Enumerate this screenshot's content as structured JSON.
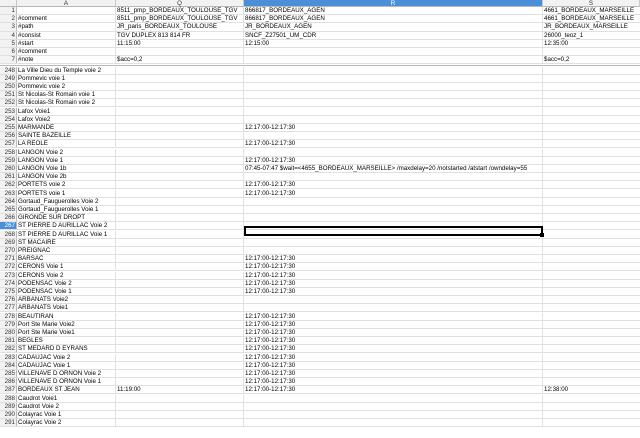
{
  "columns": [
    "A",
    "Q",
    "R",
    "S"
  ],
  "selected_column": "R",
  "selected_row": "267",
  "top_rows": [
    {
      "num": "1",
      "a": "",
      "q": "8511_pmp_BORDEAUX_TOULOUSE_TGV",
      "r": "866817_BORDEAUX_AGEN",
      "s": "4661_BORDEAUX_MARSEILLE"
    },
    {
      "num": "2",
      "a": "#comment",
      "q": "8511_pmp_BORDEAUX_TOULOUSE_TGV",
      "r": "866817_BORDEAUX_AGEN",
      "s": "4661_BORDEAUX_MARSEILLE"
    },
    {
      "num": "3",
      "a": "#path",
      "q": "JR_paris_BORDEAUX_TOULOUSE",
      "r": "JR_BORDEAUX_AGEN",
      "s": "JR_BORDEAUX_MARSEILLE"
    },
    {
      "num": "4",
      "a": "#consist",
      "q": "TGV DUPLEX 813 814 FR",
      "r": "SNCF_Z27501_UM_CDR",
      "s": "26000_teoz_1"
    },
    {
      "num": "5",
      "a": "#start",
      "q": "11:15:00",
      "r": "12:15:00",
      "s": "12:35:00"
    },
    {
      "num": "6",
      "a": "#comment",
      "q": "",
      "r": "",
      "s": ""
    },
    {
      "num": "7",
      "a": "#note",
      "q": "$acc=0,2",
      "r": "",
      "s": "$acc=0,2"
    }
  ],
  "rows": [
    {
      "num": "248",
      "a": "La Ville Dieu du Temple voie 2",
      "q": "",
      "r": "",
      "s": ""
    },
    {
      "num": "249",
      "a": "Pommevic voie 1",
      "q": "",
      "r": "",
      "s": ""
    },
    {
      "num": "250",
      "a": "Pommevic voie 2",
      "q": "",
      "r": "",
      "s": ""
    },
    {
      "num": "251",
      "a": "St Nicolas-St Romain voie 1",
      "q": "",
      "r": "",
      "s": ""
    },
    {
      "num": "252",
      "a": "St Nicolas-St Romain voie 2",
      "q": "",
      "r": "",
      "s": ""
    },
    {
      "num": "253",
      "a": "Lafox Voie1",
      "q": "",
      "r": "",
      "s": ""
    },
    {
      "num": "254",
      "a": "Lafox Voie2",
      "q": "",
      "r": "",
      "s": ""
    },
    {
      "num": "255",
      "a": "MARMANDE",
      "q": "",
      "r": "12:17:00-12:17:30",
      "s": ""
    },
    {
      "num": "256",
      "a": "SAINTE BAZEILLE",
      "q": "",
      "r": "",
      "s": ""
    },
    {
      "num": "257",
      "a": "LA REOLE",
      "q": "",
      "r": "12:17:00-12:17:30",
      "s": ""
    },
    {
      "num": "258",
      "a": "LANGON  Voie 2",
      "q": "",
      "r": "",
      "s": ""
    },
    {
      "num": "259",
      "a": "LANGON  Voie 1",
      "q": "",
      "r": "12:17:00-12:17:30",
      "s": ""
    },
    {
      "num": "260",
      "a": "LANGON  Voie 1b",
      "q": "",
      "r": "07:45-07:47 $wait=<4655_BORDEAUX_MARSEILLE> /maxdelay=20 /notstarted /atstart /owndelay=55",
      "s": ""
    },
    {
      "num": "261",
      "a": "LANGON  Voie 2b",
      "q": "",
      "r": "",
      "s": ""
    },
    {
      "num": "262",
      "a": "PORTETS voie 2",
      "q": "",
      "r": "12:17:00-12:17:30",
      "s": ""
    },
    {
      "num": "263",
      "a": "PORTETS voie 1",
      "q": "",
      "r": "12:17:00-12:17:30",
      "s": ""
    },
    {
      "num": "264",
      "a": "Gortaud_Fauguerolles Voie 2",
      "q": "",
      "r": "",
      "s": ""
    },
    {
      "num": "265",
      "a": "Gortaud_Fauguerolles Voie 1",
      "q": "",
      "r": "",
      "s": ""
    },
    {
      "num": "266",
      "a": "GIRONDE SUR DROPT",
      "q": "",
      "r": "",
      "s": ""
    },
    {
      "num": "267",
      "a": "ST PIERRE D AURILLAC Voie 2",
      "q": "",
      "r": "",
      "s": ""
    },
    {
      "num": "268",
      "a": "ST PIERRE D AURILLAC Voie 1",
      "q": "",
      "r": "",
      "s": ""
    },
    {
      "num": "269",
      "a": "ST MACAIRE",
      "q": "",
      "r": "",
      "s": ""
    },
    {
      "num": "270",
      "a": "PREIGNAC",
      "q": "",
      "r": "",
      "s": ""
    },
    {
      "num": "271",
      "a": "BARSAC",
      "q": "",
      "r": "12:17:00-12:17:30",
      "s": ""
    },
    {
      "num": "272",
      "a": "CERONS Voie 1",
      "q": "",
      "r": "12:17:00-12:17:30",
      "s": ""
    },
    {
      "num": "273",
      "a": "CERONS Voie 2",
      "q": "",
      "r": "12:17:00-12:17:30",
      "s": ""
    },
    {
      "num": "274",
      "a": "PODENSAC Voie 2",
      "q": "",
      "r": "12:17:00-12:17:30",
      "s": ""
    },
    {
      "num": "275",
      "a": "PODENSAC Voie 1",
      "q": "",
      "r": "12:17:00-12:17:30",
      "s": ""
    },
    {
      "num": "276",
      "a": "ARBANATS Voie2",
      "q": "",
      "r": "",
      "s": ""
    },
    {
      "num": "277",
      "a": "ARBANATS Voie1",
      "q": "",
      "r": "",
      "s": ""
    },
    {
      "num": "278",
      "a": "BEAUTIRAN",
      "q": "",
      "r": "12:17:00-12:17:30",
      "s": ""
    },
    {
      "num": "279",
      "a": "Port Ste Marie Voie2",
      "q": "",
      "r": "12:17:00-12:17:30",
      "s": ""
    },
    {
      "num": "280",
      "a": "Port Ste Marie Voie1",
      "q": "",
      "r": "12:17:00-12:17:30",
      "s": ""
    },
    {
      "num": "281",
      "a": "BEGLES",
      "q": "",
      "r": "12:17:00-12:17:30",
      "s": ""
    },
    {
      "num": "282",
      "a": "ST MEDARD  D EYRANS",
      "q": "",
      "r": "12:17:00-12:17:30",
      "s": ""
    },
    {
      "num": "283",
      "a": "CADAUJAC Voie 2",
      "q": "",
      "r": "12:17:00-12:17:30",
      "s": ""
    },
    {
      "num": "284",
      "a": "CADAUJAC Voie 1",
      "q": "",
      "r": "12:17:00-12:17:30",
      "s": ""
    },
    {
      "num": "285",
      "a": "VILLENAVE D ORNON Voie 2",
      "q": "",
      "r": "12:17:00-12:17:30",
      "s": ""
    },
    {
      "num": "286",
      "a": "VILLENAVE D ORNON Voie 1",
      "q": "",
      "r": "12:17:00-12:17:30",
      "s": ""
    },
    {
      "num": "287",
      "a": "BORDEAUX    ST JEAN",
      "q": "11:19:00",
      "r": "12:17:00-12:17:30",
      "s": "12:38:00"
    },
    {
      "num": "288",
      "a": "Caudrot Voie1",
      "q": "",
      "r": "",
      "s": ""
    },
    {
      "num": "289",
      "a": "Caudrot Voie 2",
      "q": "",
      "r": "",
      "s": ""
    },
    {
      "num": "290",
      "a": "Colayrac Voie 1",
      "q": "",
      "r": "",
      "s": ""
    },
    {
      "num": "291",
      "a": "Colayrac Voie 2",
      "q": "",
      "r": "",
      "s": ""
    }
  ]
}
